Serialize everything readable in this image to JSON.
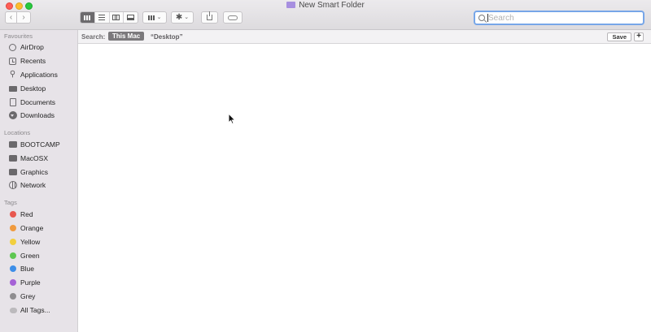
{
  "window": {
    "title": "New Smart Folder"
  },
  "toolbar": {
    "back_icon": "chevron-left-icon",
    "forward_icon": "chevron-right-icon",
    "search_placeholder": "Search"
  },
  "sidebar": {
    "favourites_heading": "Favourites",
    "favourites": [
      {
        "label": "AirDrop",
        "icon": "airdrop-icon"
      },
      {
        "label": "Recents",
        "icon": "recents-icon"
      },
      {
        "label": "Applications",
        "icon": "applications-icon"
      },
      {
        "label": "Desktop",
        "icon": "desktop-icon"
      },
      {
        "label": "Documents",
        "icon": "documents-icon"
      },
      {
        "label": "Downloads",
        "icon": "downloads-icon"
      }
    ],
    "locations_heading": "Locations",
    "locations": [
      {
        "label": "BOOTCAMP",
        "icon": "disk-icon"
      },
      {
        "label": "MacOSX",
        "icon": "disk-icon"
      },
      {
        "label": "Graphics",
        "icon": "disk-icon"
      },
      {
        "label": "Network",
        "icon": "network-icon"
      }
    ],
    "tags_heading": "Tags",
    "tags": [
      {
        "label": "Red",
        "color": "#e8574f"
      },
      {
        "label": "Orange",
        "color": "#f09a3e"
      },
      {
        "label": "Yellow",
        "color": "#f2cf3e"
      },
      {
        "label": "Green",
        "color": "#5ec751"
      },
      {
        "label": "Blue",
        "color": "#3d8ee8"
      },
      {
        "label": "Purple",
        "color": "#a561d6"
      },
      {
        "label": "Grey",
        "color": "#8f8d90"
      }
    ],
    "all_tags_label": "All Tags..."
  },
  "scopebar": {
    "search_label": "Search:",
    "scope_active": "This Mac",
    "scope_other": "“Desktop”",
    "save_label": "Save",
    "add_label": "+"
  }
}
